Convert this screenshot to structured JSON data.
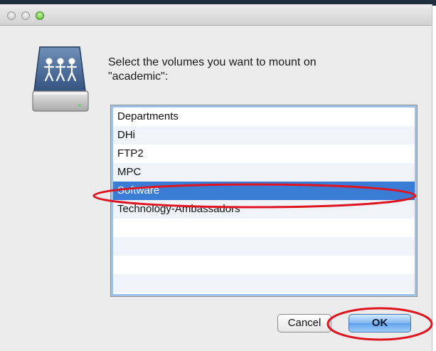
{
  "dialog": {
    "prompt": "Select the volumes you want to mount on\n\"academic\":",
    "volumes": [
      "Departments",
      "DHi",
      "FTP2",
      "MPC",
      "Software",
      "Technology-Ambassadors"
    ],
    "selected_volume": "Software",
    "buttons": {
      "cancel": "Cancel",
      "ok": "OK"
    }
  },
  "colors": {
    "selection": "#3a7bd5",
    "annotation_circle": "#e0141e",
    "zoom_light": "#54b52b"
  },
  "icons": {
    "drive": "network-server-drive-icon"
  }
}
